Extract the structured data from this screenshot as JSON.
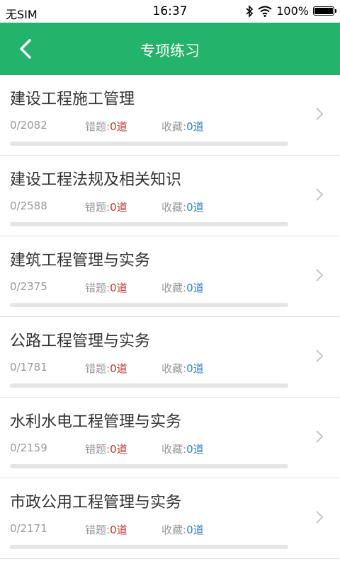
{
  "status": {
    "carrier": "无SIM",
    "time": "16:37",
    "battery": "100%"
  },
  "header": {
    "title": "专项练习"
  },
  "colors": {
    "header_bg": "#23b36a",
    "wrong_count": "#c0392b",
    "fav_count": "#2f7fd1"
  },
  "items": [
    {
      "name": "建设工程施工管理",
      "count": "0/2082",
      "wrong_label": "错题:",
      "wrong": "0道",
      "fav_label": "收藏:",
      "fav": "0道",
      "progress": 0
    },
    {
      "name": "建设工程法规及相关知识",
      "count": "0/2588",
      "wrong_label": "错题:",
      "wrong": "0道",
      "fav_label": "收藏:",
      "fav": "0道",
      "progress": 0
    },
    {
      "name": "建筑工程管理与实务",
      "count": "0/2375",
      "wrong_label": "错题:",
      "wrong": "0道",
      "fav_label": "收藏:",
      "fav": "0道",
      "progress": 0
    },
    {
      "name": "公路工程管理与实务",
      "count": "0/1781",
      "wrong_label": "错题:",
      "wrong": "0道",
      "fav_label": "收藏:",
      "fav": "0道",
      "progress": 0
    },
    {
      "name": "水利水电工程管理与实务",
      "count": "0/2159",
      "wrong_label": "错题:",
      "wrong": "0道",
      "fav_label": "收藏:",
      "fav": "0道",
      "progress": 0
    },
    {
      "name": "市政公用工程管理与实务",
      "count": "0/2171",
      "wrong_label": "错题:",
      "wrong": "0道",
      "fav_label": "收藏:",
      "fav": "0道",
      "progress": 0
    }
  ]
}
